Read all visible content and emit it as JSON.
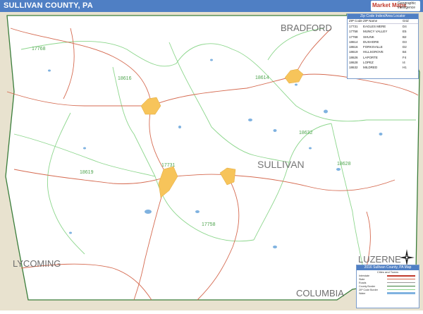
{
  "title": "SULLIVAN COUNTY, PA",
  "brand": {
    "name": "Market Maps",
    "tagline": "Geographic intelligence"
  },
  "county_name": "SULLIVAN",
  "neighbors": {
    "north": "BRADFORD",
    "west": "LYCOMING",
    "southeast": "LUZERNE",
    "south": "COLUMBIA"
  },
  "zip_labels": [
    "17768",
    "18616",
    "18614",
    "18632",
    "18628",
    "18619",
    "17731",
    "17758"
  ],
  "zip_table": {
    "title": "Zip Code Index/Area Locator",
    "headers": [
      "ZIP Code",
      "ZIP Name",
      "Grid"
    ],
    "rows": [
      [
        "17731",
        "EAGLES MERE",
        "D4"
      ],
      [
        "17758",
        "MUNCY VALLEY",
        "E5"
      ],
      [
        "17768",
        "SHUNK",
        "B2"
      ],
      [
        "18614",
        "DUSHORE",
        "D3"
      ],
      [
        "18616",
        "FORKSVILLE",
        "D2"
      ],
      [
        "18619",
        "HILLSGROVE",
        "B4"
      ],
      [
        "18626",
        "LAPORTE",
        "F4"
      ],
      [
        "18628",
        "LOPEZ",
        "I4"
      ],
      [
        "18632",
        "MILDRED",
        "H1"
      ]
    ]
  },
  "legend": {
    "title": "2016 Sullivan County, PA Map",
    "subtitle": "Cities and Towns",
    "items": [
      "Interstate",
      "State",
      "Roads",
      "County Border",
      "ZIP Code Border",
      "Water"
    ]
  },
  "colors": {
    "header": "#4f7fc4",
    "outside": "#e8e2cf",
    "county_fill": "#ffffff",
    "zip_border": "#8cd68c",
    "road": "#d56a50",
    "town": "#f7c45a",
    "water": "#7fb2e0"
  }
}
